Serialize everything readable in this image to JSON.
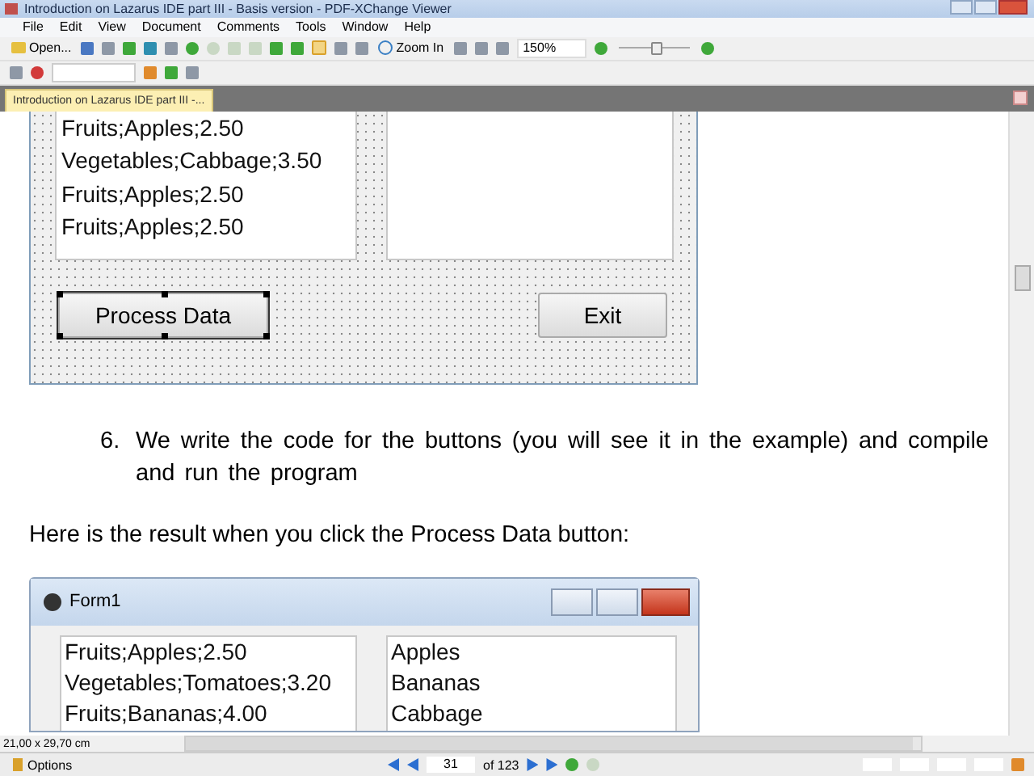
{
  "window": {
    "title": "Introduction on Lazarus IDE part III - Basis version - PDF-XChange Viewer"
  },
  "menu": [
    "File",
    "Edit",
    "View",
    "Document",
    "Comments",
    "Tools",
    "Window",
    "Help"
  ],
  "toolbar": {
    "open_label": "Open...",
    "zoom_label": "Zoom In",
    "zoom_value": "150%",
    "zoom_slider": {
      "level": 0.5
    }
  },
  "tabs": [
    {
      "label": "Introduction on Lazarus IDE part III -...",
      "selected": true
    }
  ],
  "document": {
    "form_screenshot": {
      "list_left": [
        "Fruits;Apples;2.50",
        "Vegetables;Cabbage;3.50",
        "Fruits;Apples;2.50",
        "Fruits;Apples;2.50"
      ],
      "buttons": [
        {
          "label": "Process Data",
          "selected": true
        },
        {
          "label": "Exit",
          "selected": false
        }
      ]
    },
    "step": {
      "number": "6.",
      "text": "We write the code for the buttons (you will see it in the example) and compile and run the program"
    },
    "paragraph": "Here is the result when you click the Process Data button:",
    "form_window": {
      "title": "Form1",
      "list_left": [
        "Fruits;Apples;2.50",
        "Vegetables;Tomatoes;3.20",
        "Fruits;Bananas;4.00"
      ],
      "list_right": [
        "Apples",
        "Bananas",
        "Cabbage"
      ]
    }
  },
  "status_bar": {
    "page_size": "21,00 x 29,70 cm",
    "options": "Options",
    "page": "31",
    "page_count": "of 123"
  }
}
